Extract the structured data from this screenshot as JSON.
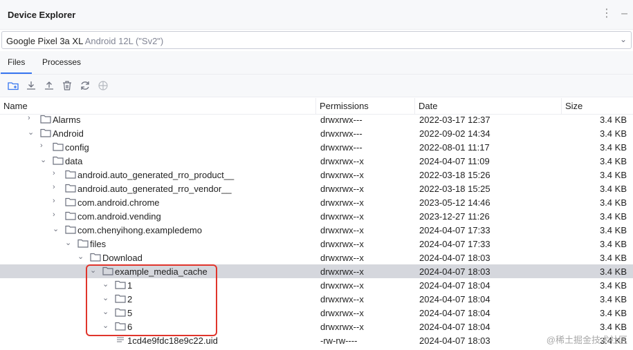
{
  "window": {
    "title": "Device Explorer",
    "menu_glyph": "⋮",
    "minimize_glyph": "–"
  },
  "device_selector": {
    "device": "Google Pixel 3a XL",
    "version": "Android 12L (\"Sv2\")"
  },
  "tabs": [
    {
      "label": "Files",
      "active": true
    },
    {
      "label": "Processes",
      "active": false
    }
  ],
  "toolbar": {
    "icons": [
      "new-folder-icon",
      "download-icon",
      "upload-icon",
      "delete-icon",
      "refresh-icon",
      "sync-icon"
    ]
  },
  "columns": {
    "name": "Name",
    "permissions": "Permissions",
    "date": "Date",
    "size": "Size"
  },
  "rows": [
    {
      "name": "Alarms",
      "type": "folder",
      "depth": 0,
      "expanded": false,
      "permissions": "drwxrwx---",
      "date": "2022-03-17 12:37",
      "size": "3.4 KB"
    },
    {
      "name": "Android",
      "type": "folder",
      "depth": 0,
      "expanded": true,
      "permissions": "drwxrwx---",
      "date": "2022-09-02 14:34",
      "size": "3.4 KB"
    },
    {
      "name": "config",
      "type": "folder",
      "depth": 1,
      "expanded": false,
      "permissions": "drwxrwx---",
      "date": "2022-08-01 11:17",
      "size": "3.4 KB"
    },
    {
      "name": "data",
      "type": "folder",
      "depth": 1,
      "expanded": true,
      "permissions": "drwxrwx--x",
      "date": "2024-04-07 11:09",
      "size": "3.4 KB"
    },
    {
      "name": "android.auto_generated_rro_product__",
      "type": "folder",
      "depth": 2,
      "expanded": false,
      "permissions": "drwxrwx--x",
      "date": "2022-03-18 15:26",
      "size": "3.4 KB"
    },
    {
      "name": "android.auto_generated_rro_vendor__",
      "type": "folder",
      "depth": 2,
      "expanded": false,
      "permissions": "drwxrwx--x",
      "date": "2022-03-18 15:25",
      "size": "3.4 KB"
    },
    {
      "name": "com.android.chrome",
      "type": "folder",
      "depth": 2,
      "expanded": false,
      "permissions": "drwxrwx--x",
      "date": "2023-05-12 14:46",
      "size": "3.4 KB"
    },
    {
      "name": "com.android.vending",
      "type": "folder",
      "depth": 2,
      "expanded": false,
      "permissions": "drwxrwx--x",
      "date": "2023-12-27 11:26",
      "size": "3.4 KB"
    },
    {
      "name": "com.chenyihong.exampledemo",
      "type": "folder",
      "depth": 2,
      "expanded": true,
      "permissions": "drwxrwx--x",
      "date": "2024-04-07 17:33",
      "size": "3.4 KB"
    },
    {
      "name": "files",
      "type": "folder",
      "depth": 3,
      "expanded": true,
      "permissions": "drwxrwx--x",
      "date": "2024-04-07 17:33",
      "size": "3.4 KB"
    },
    {
      "name": "Download",
      "type": "folder",
      "depth": 4,
      "expanded": true,
      "permissions": "drwxrwx--x",
      "date": "2024-04-07 18:03",
      "size": "3.4 KB"
    },
    {
      "name": "example_media_cache",
      "type": "folder",
      "depth": 5,
      "expanded": true,
      "selected": true,
      "permissions": "drwxrwx--x",
      "date": "2024-04-07 18:03",
      "size": "3.4 KB"
    },
    {
      "name": "1",
      "type": "folder",
      "depth": 6,
      "expanded": true,
      "permissions": "drwxrwx--x",
      "date": "2024-04-07 18:04",
      "size": "3.4 KB"
    },
    {
      "name": "2",
      "type": "folder",
      "depth": 6,
      "expanded": true,
      "permissions": "drwxrwx--x",
      "date": "2024-04-07 18:04",
      "size": "3.4 KB"
    },
    {
      "name": "5",
      "type": "folder",
      "depth": 6,
      "expanded": true,
      "permissions": "drwxrwx--x",
      "date": "2024-04-07 18:04",
      "size": "3.4 KB"
    },
    {
      "name": "6",
      "type": "folder",
      "depth": 6,
      "expanded": true,
      "permissions": "drwxrwx--x",
      "date": "2024-04-07 18:04",
      "size": "3.4 KB"
    },
    {
      "name": "1cd4e9fdc18e9c22.uid",
      "type": "file",
      "depth": 6,
      "permissions": "-rw-rw----",
      "date": "2024-04-07 18:03",
      "size": "3.4 KB"
    }
  ],
  "watermark": "@稀土掘金技术社区",
  "colors": {
    "accent": "#3574f0",
    "selection": "#d5d7dd",
    "highlight": "#e0342b",
    "folder": "#6c707e"
  }
}
